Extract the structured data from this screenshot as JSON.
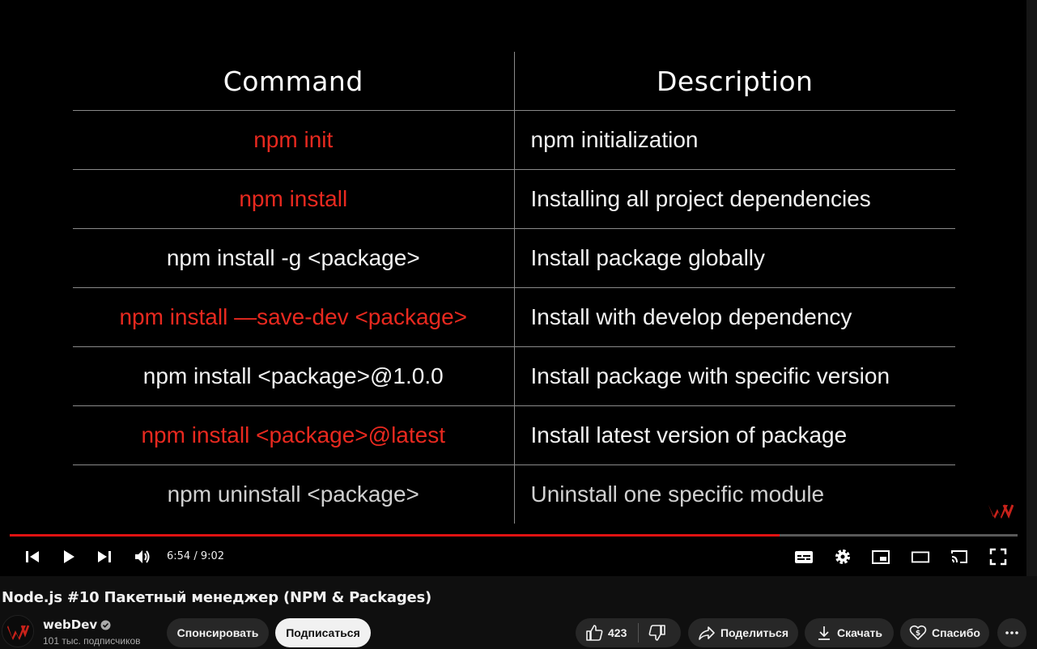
{
  "slide": {
    "headers": [
      "Command",
      "Description"
    ],
    "rows": [
      {
        "command": "npm init",
        "description": "npm initialization",
        "highlight": true
      },
      {
        "command": "npm install",
        "description": "Installing all project dependencies",
        "highlight": true
      },
      {
        "command": "npm install -g <package>",
        "description": "Install package globally",
        "highlight": false
      },
      {
        "command": "npm install —save-dev <package>",
        "description": "Install with develop dependency",
        "highlight": true
      },
      {
        "command": "npm install <package>@1.0.0",
        "description": "Install package with specific version",
        "highlight": false
      },
      {
        "command": "npm install <package>@latest",
        "description": "Install latest version of package",
        "highlight": true
      },
      {
        "command": "npm uninstall <package>",
        "description": "Uninstall one specific module",
        "highlight": false
      }
    ],
    "highlight_color": "#e8291f"
  },
  "player": {
    "time_display": "6:54 / 9:02",
    "progress_fraction": 0.7638,
    "progress_color": "#e01212",
    "controls_left": [
      "previous-icon",
      "play-icon",
      "next-icon",
      "volume-icon"
    ],
    "controls_right": [
      "subtitles-icon",
      "settings-icon",
      "miniplayer-icon",
      "theater-icon",
      "cast-icon",
      "fullscreen-icon"
    ]
  },
  "video": {
    "title": "Node.js #10 Пакетный менеджер (NPM & Packages)"
  },
  "channel": {
    "name": "webDev",
    "subscribers": "101 тыс. подписчиков",
    "verified_icon": "verified-check-icon"
  },
  "actions": {
    "sponsor": "Спонсировать",
    "subscribe": "Подписаться",
    "likes": "423",
    "share": "Поделиться",
    "download": "Скачать",
    "thanks": "Спасибо"
  }
}
